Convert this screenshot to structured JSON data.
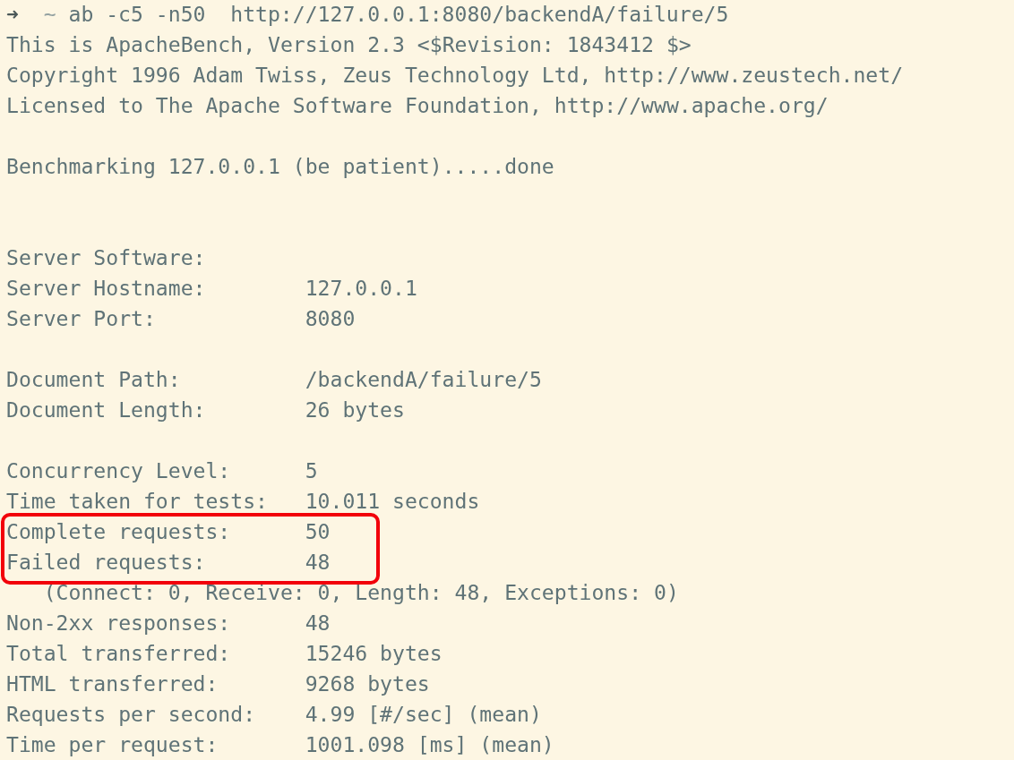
{
  "terminal": {
    "lines": [
      {
        "kind": "prompt",
        "symbol": "➜",
        "cwd": "~",
        "command": "ab -c5 -n50  http://127.0.0.1:8080/backendA/failure/5"
      },
      {
        "kind": "text",
        "text": "This is ApacheBench, Version 2.3 <$Revision: 1843412 $>"
      },
      {
        "kind": "text",
        "text": "Copyright 1996 Adam Twiss, Zeus Technology Ltd, http://www.zeustech.net/"
      },
      {
        "kind": "text",
        "text": "Licensed to The Apache Software Foundation, http://www.apache.org/"
      },
      {
        "kind": "blank"
      },
      {
        "kind": "text",
        "text": "Benchmarking 127.0.0.1 (be patient).....done"
      },
      {
        "kind": "blank"
      },
      {
        "kind": "blank"
      },
      {
        "kind": "field",
        "label": "Server Software:",
        "highlighted": false
      },
      {
        "kind": "field",
        "label": "Server Hostname:",
        "value": "127.0.0.1",
        "highlighted": false
      },
      {
        "kind": "field",
        "label": "Server Port:",
        "value": "8080",
        "highlighted": false
      },
      {
        "kind": "blank"
      },
      {
        "kind": "field",
        "label": "Document Path:",
        "value": "/backendA/failure/5",
        "highlighted": false
      },
      {
        "kind": "field",
        "label": "Document Length:",
        "value": "26 bytes",
        "highlighted": false
      },
      {
        "kind": "blank"
      },
      {
        "kind": "field",
        "label": "Concurrency Level:",
        "value": "5",
        "highlighted": false
      },
      {
        "kind": "field",
        "label": "Time taken for tests:",
        "value": "10.011 seconds",
        "highlighted": false
      },
      {
        "kind": "field",
        "label": "Complete requests:",
        "value": "50",
        "highlighted": true
      },
      {
        "kind": "field",
        "label": "Failed requests:",
        "value": "48",
        "highlighted": true
      },
      {
        "kind": "text",
        "text": "   (Connect: 0, Receive: 0, Length: 48, Exceptions: 0)"
      },
      {
        "kind": "field",
        "label": "Non-2xx responses:",
        "value": "48",
        "highlighted": false
      },
      {
        "kind": "field",
        "label": "Total transferred:",
        "value": "15246 bytes",
        "highlighted": false
      },
      {
        "kind": "field",
        "label": "HTML transferred:",
        "value": "9268 bytes",
        "highlighted": false
      },
      {
        "kind": "field",
        "label": "Requests per second:",
        "value": "4.99 [#/sec] (mean)",
        "highlighted": false
      },
      {
        "kind": "field",
        "label": "Time per request:",
        "value": "1001.098 [ms] (mean)",
        "highlighted": false
      }
    ]
  }
}
